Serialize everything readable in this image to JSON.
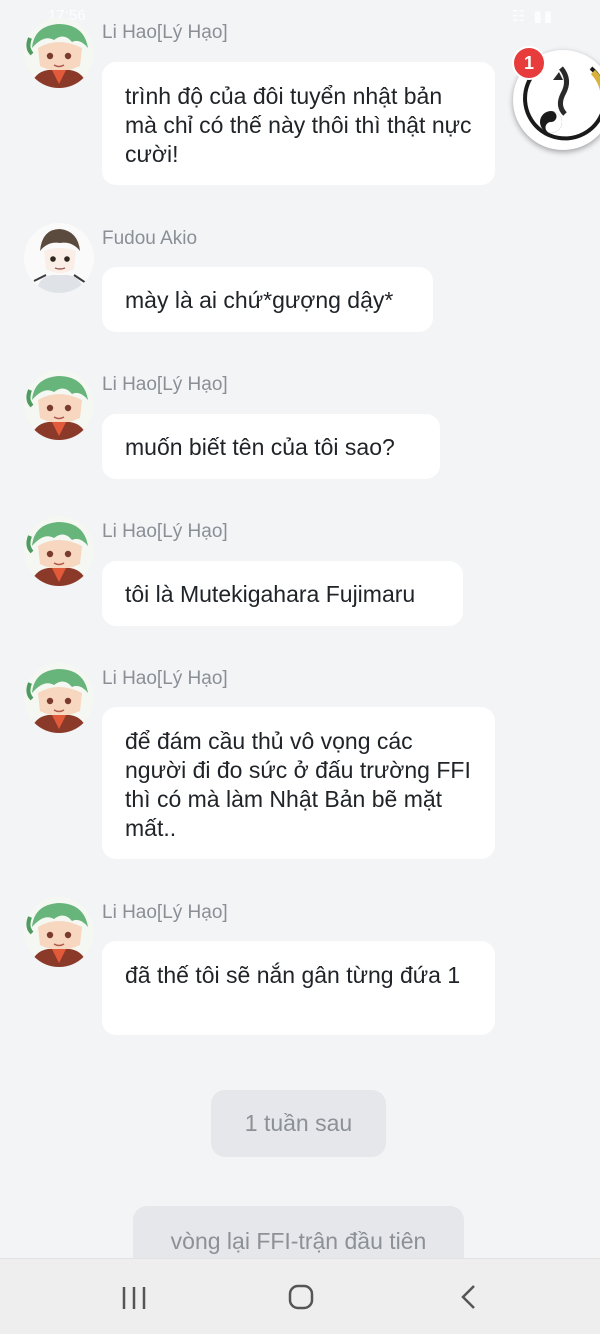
{
  "status_bar": {
    "time": "17:56",
    "right_icons": "☷ ▮▮"
  },
  "floating_button": {
    "badge_count": "1",
    "icon": "yin-yang-wolf-icon"
  },
  "messages": [
    {
      "sender": "Li Hao[Lý Hạo]",
      "avatar": "li-hao-avatar",
      "text": "trình độ của đôi tuyển nhật bản mà chỉ có thế này thôi thì thật nực cười!"
    },
    {
      "sender": "Fudou Akio",
      "avatar": "fudou-akio-avatar",
      "text": "mày là ai chứ*gượng dậy*"
    },
    {
      "sender": "Li Hao[Lý Hạo]",
      "avatar": "li-hao-avatar",
      "text": "muốn biết tên của tôi sao?"
    },
    {
      "sender": "Li Hao[Lý Hạo]",
      "avatar": "li-hao-avatar",
      "text": "tôi là Mutekigahara Fujimaru"
    },
    {
      "sender": "Li Hao[Lý Hạo]",
      "avatar": "li-hao-avatar",
      "text": "để đám cầu thủ vô vọng các người đi đo sức ở đấu trường FFI thì có mà làm Nhật Bản bẽ mặt mất.."
    },
    {
      "sender": "Li Hao[Lý Hạo]",
      "avatar": "li-hao-avatar",
      "text": "đã thế tôi sẽ nắn gân từng đứa 1"
    }
  ],
  "system_messages": [
    {
      "text": "1 tuần sau"
    },
    {
      "text": "vòng lại FFI-trận đầu tiên"
    }
  ],
  "nav_bar": {
    "recent_icon": "recent-apps-icon",
    "home_icon": "home-icon",
    "back_icon": "back-icon"
  }
}
